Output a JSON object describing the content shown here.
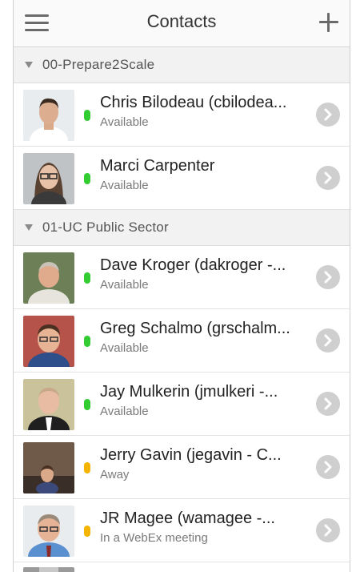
{
  "header": {
    "title": "Contacts"
  },
  "groups": [
    {
      "label": "00-Prepare2Scale",
      "contacts": [
        {
          "name": "Chris Bilodeau (cbilodea...",
          "status": "Available",
          "status_color": "#33cc33"
        },
        {
          "name": "Marci Carpenter",
          "status": "Available",
          "status_color": "#33cc33"
        }
      ]
    },
    {
      "label": "01-UC Public Sector",
      "contacts": [
        {
          "name": "Dave Kroger (dakroger -...",
          "status": "Available",
          "status_color": "#33cc33"
        },
        {
          "name": "Greg Schalmo (grschalm...",
          "status": "Available",
          "status_color": "#33cc33"
        },
        {
          "name": "Jay Mulkerin (jmulkeri -...",
          "status": "Available",
          "status_color": "#33cc33"
        },
        {
          "name": "Jerry Gavin (jegavin - C...",
          "status": "Away",
          "status_color": "#f5b400"
        },
        {
          "name": "JR Magee (wamagee -...",
          "status": "In a WebEx meeting",
          "status_color": "#f5b400"
        }
      ]
    }
  ],
  "icons": {
    "menu": "hamburger-menu-icon",
    "add": "plus-icon",
    "group_toggle": "triangle-down-icon",
    "row_action": "chevron-right-circle-icon"
  }
}
